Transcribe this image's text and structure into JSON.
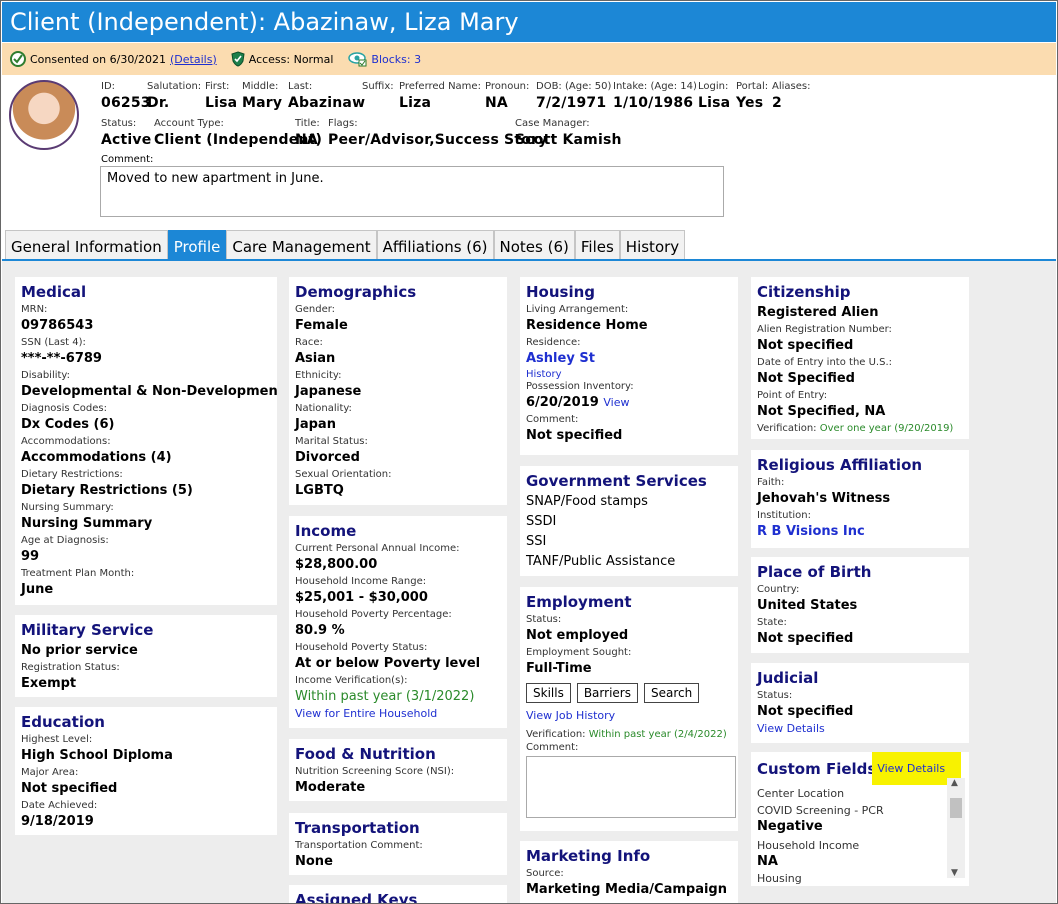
{
  "title": "Client (Independent): Abazinaw, Liza Mary",
  "status_bar": {
    "consented": "Consented on 6/30/2021",
    "details_link": "(Details)",
    "access": "Access: Normal",
    "blocks": "Blocks: 3"
  },
  "header": {
    "id_label": "ID:",
    "id": "06253",
    "salutation_label": "Salutation:",
    "salutation": "Dr.",
    "first_label": "First:",
    "first": "Lisa",
    "middle_label": "Middle:",
    "middle": "Mary",
    "last_label": "Last:",
    "last": "Abazinaw",
    "suffix_label": "Suffix:",
    "preferred_label": "Preferred Name:",
    "preferred": "Liza",
    "pronoun_label": "Pronoun:",
    "pronoun": "NA",
    "dob_label": "DOB: (Age: 50)",
    "dob": "7/2/1971",
    "intake_label": "Intake: (Age: 14)",
    "intake": "1/10/1986",
    "login_label": "Login:",
    "login": "Lisa",
    "portal_label": "Portal:",
    "portal": "Yes",
    "aliases_label": "Aliases:",
    "aliases": "2",
    "status_label": "Status:",
    "status": "Active",
    "account_type_label": "Account Type:",
    "account_type": "Client (Independent)",
    "title_label": "Title:",
    "title_val": "NA",
    "flags_label": "Flags:",
    "flags": "Peer/Advisor,Success Story",
    "case_manager_label": "Case Manager:",
    "case_manager": "Scott Kamish",
    "comment_label": "Comment:",
    "comment": "Moved to new apartment in June."
  },
  "tabs": [
    "General Information",
    "Profile",
    "Care Management",
    "Affiliations (6)",
    "Notes (6)",
    "Files",
    "History"
  ],
  "medical": {
    "title": "Medical",
    "mrn_label": "MRN:",
    "mrn": "09786543",
    "ssn_label": "SSN (Last 4):",
    "ssn": "***-**-6789",
    "disability_label": "Disability:",
    "disability": "Developmental & Non-Developmental",
    "dx_label": "Diagnosis Codes:",
    "dx": "Dx Codes (6)",
    "acc_label": "Accommodations:",
    "acc": "Accommodations (4)",
    "diet_label": "Dietary Restrictions:",
    "diet": "Dietary Restrictions (5)",
    "nursing_label": "Nursing Summary:",
    "nursing": "Nursing Summary",
    "age_label": "Age at Diagnosis:",
    "age": "99",
    "tpm_label": "Treatment Plan Month:",
    "tpm": "June"
  },
  "military": {
    "title": "Military Service",
    "value": "No prior service",
    "reg_label": "Registration Status:",
    "reg": "Exempt"
  },
  "education": {
    "title": "Education",
    "level_label": "Highest Level:",
    "level": "High School Diploma",
    "major_label": "Major Area:",
    "major": "Not specified",
    "date_label": "Date Achieved:",
    "date": "9/18/2019"
  },
  "demographics": {
    "title": "Demographics",
    "gender_label": "Gender:",
    "gender": "Female",
    "race_label": "Race:",
    "race": "Asian",
    "eth_label": "Ethnicity:",
    "eth": "Japanese",
    "nat_label": "Nationality:",
    "nat": "Japan",
    "marital_label": "Marital Status:",
    "marital": "Divorced",
    "orient_label": "Sexual Orientation:",
    "orient": "LGBTQ"
  },
  "income": {
    "title": "Income",
    "cur_label": "Current Personal Annual Income:",
    "cur": "$28,800.00",
    "range_label": "Household Income Range:",
    "range": "$25,001 - $30,000",
    "pov_label": "Household Poverty Percentage:",
    "pov": "80.9 %",
    "povstat_label": "Household Poverty Status:",
    "povstat": "At or below Poverty level",
    "ver_label": "Income Verification(s):",
    "ver": "Within past year (3/1/2022)",
    "household_link": "View for Entire Household"
  },
  "food": {
    "title": "Food & Nutrition",
    "nsi_label": "Nutrition Screening Score (NSI):",
    "nsi": "Moderate"
  },
  "transportation": {
    "title": "Transportation",
    "comment_label": "Transportation Comment:",
    "comment": "None"
  },
  "assigned_keys": {
    "title": "Assigned Keys"
  },
  "housing": {
    "title": "Housing",
    "arr_label": "Living Arrangement:",
    "arr": "Residence Home",
    "res_label": "Residence:",
    "res": "Ashley St",
    "history_link": "History",
    "poss_label": "Possession Inventory:",
    "poss": "6/20/2019",
    "poss_link": "View",
    "comment_label": "Comment:",
    "comment": "Not specified"
  },
  "government": {
    "title": "Government Services",
    "items": [
      "SNAP/Food stamps",
      "SSDI",
      "SSI",
      "TANF/Public Assistance"
    ]
  },
  "employment": {
    "title": "Employment",
    "status_label": "Status:",
    "status": "Not employed",
    "sought_label": "Employment Sought:",
    "sought": "Full-Time",
    "skills": "Skills",
    "barriers": "Barriers",
    "search": "Search",
    "history_link": "View Job History",
    "ver_label": "Verification:",
    "ver": "Within past year (2/4/2022)",
    "comment_label": "Comment:"
  },
  "marketing": {
    "title": "Marketing Info",
    "source_label": "Source:",
    "source": "Marketing Media/Campaign"
  },
  "citizenship": {
    "title": "Citizenship",
    "value": "Registered Alien",
    "arn_label": "Alien Registration Number:",
    "arn": "Not specified",
    "entry_label": "Date of Entry into the U.S.:",
    "entry": "Not Specified",
    "poe_label": "Point of Entry:",
    "poe": "Not Specified, NA",
    "ver_label": "Verification:",
    "ver": "Over one year (9/20/2019)"
  },
  "religion": {
    "title": "Religious Affiliation",
    "faith_label": "Faith:",
    "faith": "Jehovah's Witness",
    "inst_label": "Institution:",
    "inst": "R B Visions Inc"
  },
  "birth": {
    "title": "Place of Birth",
    "country_label": "Country:",
    "country": "United States",
    "state_label": "State:",
    "state": "Not specified"
  },
  "judicial": {
    "title": "Judicial",
    "status_label": "Status:",
    "status": "Not specified",
    "details_link": "View Details"
  },
  "custom": {
    "title": "Custom Fields",
    "details_link": "View Details",
    "center_label": "Center Location",
    "covid_label": "COVID Screening - PCR",
    "covid": "Negative",
    "hhinc_label": "Household Income",
    "hhinc": "NA",
    "housing_label": "Housing"
  }
}
